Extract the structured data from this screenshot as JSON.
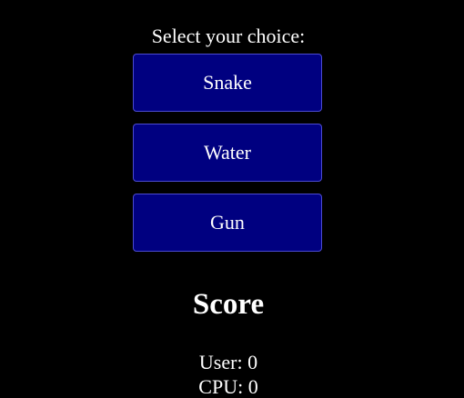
{
  "prompt": "Select your choice:",
  "choices": [
    {
      "label": "Snake"
    },
    {
      "label": "Water"
    },
    {
      "label": "Gun"
    }
  ],
  "score": {
    "heading": "Score",
    "user": "User: 0",
    "cpu": "CPU: 0"
  },
  "colors": {
    "background": "#000000",
    "button": "#000080",
    "button_border": "#4b4bd0",
    "text": "#ffffff"
  }
}
